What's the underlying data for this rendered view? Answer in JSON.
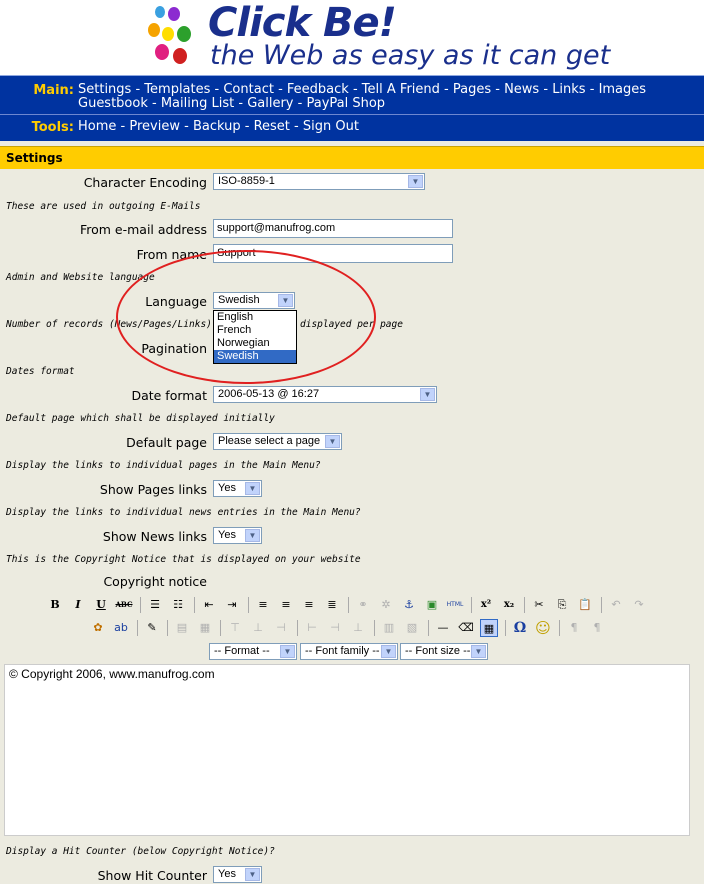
{
  "header": {
    "logo_title": "Click Be!",
    "logo_tagline": "the Web as easy as it can get"
  },
  "nav": {
    "main_label": "Main:",
    "main_links_row1": [
      "Settings",
      "Templates",
      "Contact",
      "Feedback",
      "Tell A Friend",
      "Pages",
      "News",
      "Links",
      "Images"
    ],
    "main_links_row2": [
      "Guestbook",
      "Mailing List",
      "Gallery",
      "PayPal Shop"
    ],
    "tools_label": "Tools:",
    "tools_links": [
      "Home",
      "Preview",
      "Backup",
      "Reset",
      "Sign Out"
    ],
    "separator": "-"
  },
  "section_title": "Settings",
  "form": {
    "char_encoding_label": "Character Encoding",
    "char_encoding_value": "ISO-8859-1",
    "email_note": "These are used in outgoing E-Mails",
    "from_email_label": "From e-mail address",
    "from_email_value": "support@manufrog.com",
    "from_name_label": "From name",
    "from_name_value": "Support",
    "lang_note": "Admin and Website language",
    "language_label": "Language",
    "language_value": "Swedish",
    "language_options": [
      "English",
      "French",
      "Norwegian",
      "Swedish"
    ],
    "records_note_left": "Number of records (News/Pages/Links)",
    "records_note_right": "displayed per page",
    "pagination_label": "Pagination",
    "dates_note": "Dates format",
    "date_format_label": "Date format",
    "date_format_value": "2006-05-13 @ 16:27",
    "default_page_note": "Default page which shall be displayed initially",
    "default_page_label": "Default page",
    "default_page_value": "Please select a page",
    "pages_links_note": "Display the links to individual pages in the Main Menu?",
    "pages_links_label": "Show Pages links",
    "pages_links_value": "Yes",
    "news_links_note": "Display the links to individual news entries in the Main Menu?",
    "news_links_label": "Show News links",
    "news_links_value": "Yes",
    "copyright_note": "This is the Copyright Notice that is displayed on your website",
    "copyright_label": "Copyright notice",
    "editor_format": "-- Format --",
    "editor_font_family": "-- Font family --",
    "editor_font_size": "-- Font size --",
    "editor_content": "© Copyright 2006, www.manufrog.com",
    "hit_counter_note": "Display a Hit Counter (below Copyright Notice)?",
    "hit_counter_label": "Show Hit Counter",
    "hit_counter_value": "Yes"
  },
  "toolbar": {
    "bold": "B",
    "italic": "I",
    "underline": "U",
    "strike": "ABC",
    "html": "HTML",
    "superscript": "x²",
    "subscript": "x₂",
    "omega": "Ω"
  }
}
